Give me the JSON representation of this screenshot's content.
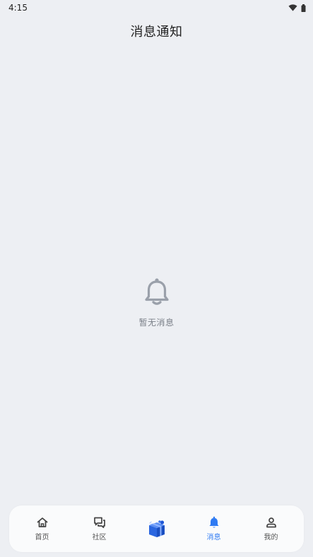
{
  "status_bar": {
    "time": "4:15",
    "icons": [
      "wifi-icon",
      "battery-icon"
    ]
  },
  "header": {
    "title": "消息通知"
  },
  "empty_state": {
    "icon": "bell-icon",
    "text": "暂无消息"
  },
  "bottom_nav": {
    "items": [
      {
        "label": "首页",
        "icon": "home-icon",
        "active": false
      },
      {
        "label": "社区",
        "icon": "chat-bubbles-icon",
        "active": false
      },
      {
        "label": "",
        "icon": "gift-box-icon",
        "active": false
      },
      {
        "label": "消息",
        "icon": "bell-icon",
        "active": true
      },
      {
        "label": "我的",
        "icon": "person-icon",
        "active": false
      }
    ]
  },
  "colors": {
    "background": "#edeff3",
    "accent": "#2f7bf3",
    "muted_icon": "#9aa0aa",
    "nav_icon": "#444444"
  }
}
